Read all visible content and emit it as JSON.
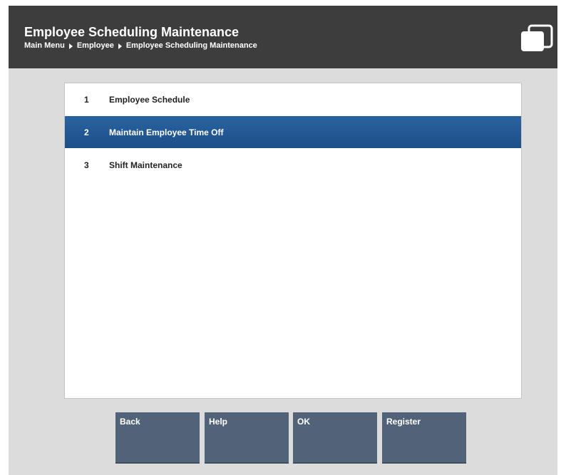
{
  "header": {
    "title": "Employee Scheduling Maintenance",
    "breadcrumb": [
      "Main Menu",
      "Employee",
      "Employee Scheduling Maintenance"
    ]
  },
  "menu": {
    "items": [
      {
        "number": "1",
        "label": "Employee Schedule",
        "selected": false
      },
      {
        "number": "2",
        "label": "Maintain Employee Time Off",
        "selected": true
      },
      {
        "number": "3",
        "label": "Shift Maintenance",
        "selected": false
      }
    ]
  },
  "buttons": {
    "back": "Back",
    "help": "Help",
    "ok": "OK",
    "register": "Register"
  },
  "colors": {
    "header_bg": "#3d3d3d",
    "selected_bg": "#2a62a0",
    "button_bg": "#526379",
    "frame_bg": "#dcdcdc"
  },
  "icons": {
    "window": "windows-stack-icon"
  }
}
